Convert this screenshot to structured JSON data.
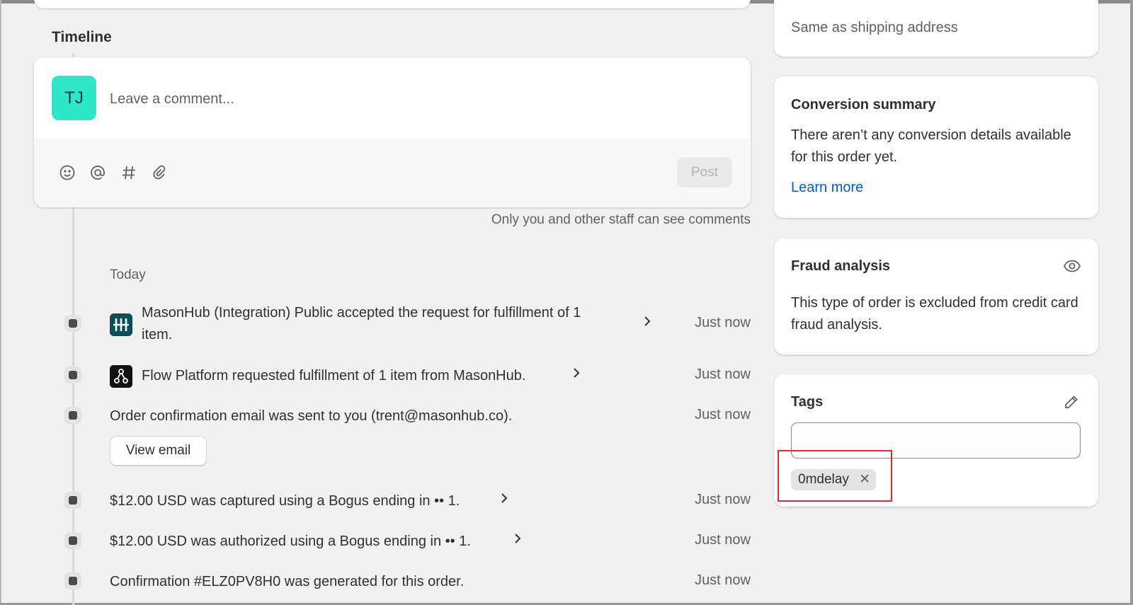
{
  "timeline": {
    "title": "Timeline",
    "comment": {
      "avatar_initials": "TJ",
      "placeholder": "Leave a comment...",
      "tools": [
        "emoji-icon",
        "mention-icon",
        "hashtag-icon",
        "attachment-icon"
      ],
      "post_label": "Post",
      "staff_note": "Only you and other staff can see comments"
    },
    "day_label": "Today",
    "events": [
      {
        "app": "MasonHub",
        "text_line1": "MasonHub (Integration) Public accepted the request for fulfillment of 1",
        "text_line2": "item.",
        "time": "Just now",
        "has_chevron": true
      },
      {
        "app": "Flow Platform",
        "text": "Flow Platform requested fulfillment of 1 item from MasonHub.",
        "time": "Just now",
        "has_chevron": true
      },
      {
        "text": "Order confirmation email was sent to you (trent@masonhub.co).",
        "time": "Just now",
        "button_label": "View email"
      },
      {
        "text": "$12.00 USD was captured using a Bogus ending in •• 1.",
        "time": "Just now",
        "has_chevron": true
      },
      {
        "text": "$12.00 USD was authorized using a Bogus ending in •• 1.",
        "time": "Just now",
        "has_chevron": true
      },
      {
        "text": "Confirmation #ELZ0PV8H0 was generated for this order.",
        "time": "Just now"
      }
    ]
  },
  "sidebar": {
    "billing": {
      "text": "Same as shipping address"
    },
    "conversion": {
      "title": "Conversion summary",
      "text": "There aren’t any conversion details available for this order yet.",
      "link": "Learn more"
    },
    "fraud": {
      "title": "Fraud analysis",
      "text": "This type of order is excluded from credit card fraud analysis."
    },
    "tags": {
      "title": "Tags",
      "input_value": "",
      "items": [
        "0mdelay"
      ]
    }
  },
  "colors": {
    "background": "#f1f1f1",
    "avatar": "#2ee6c8",
    "link": "#005bd3",
    "highlight": "#e22b2b"
  }
}
